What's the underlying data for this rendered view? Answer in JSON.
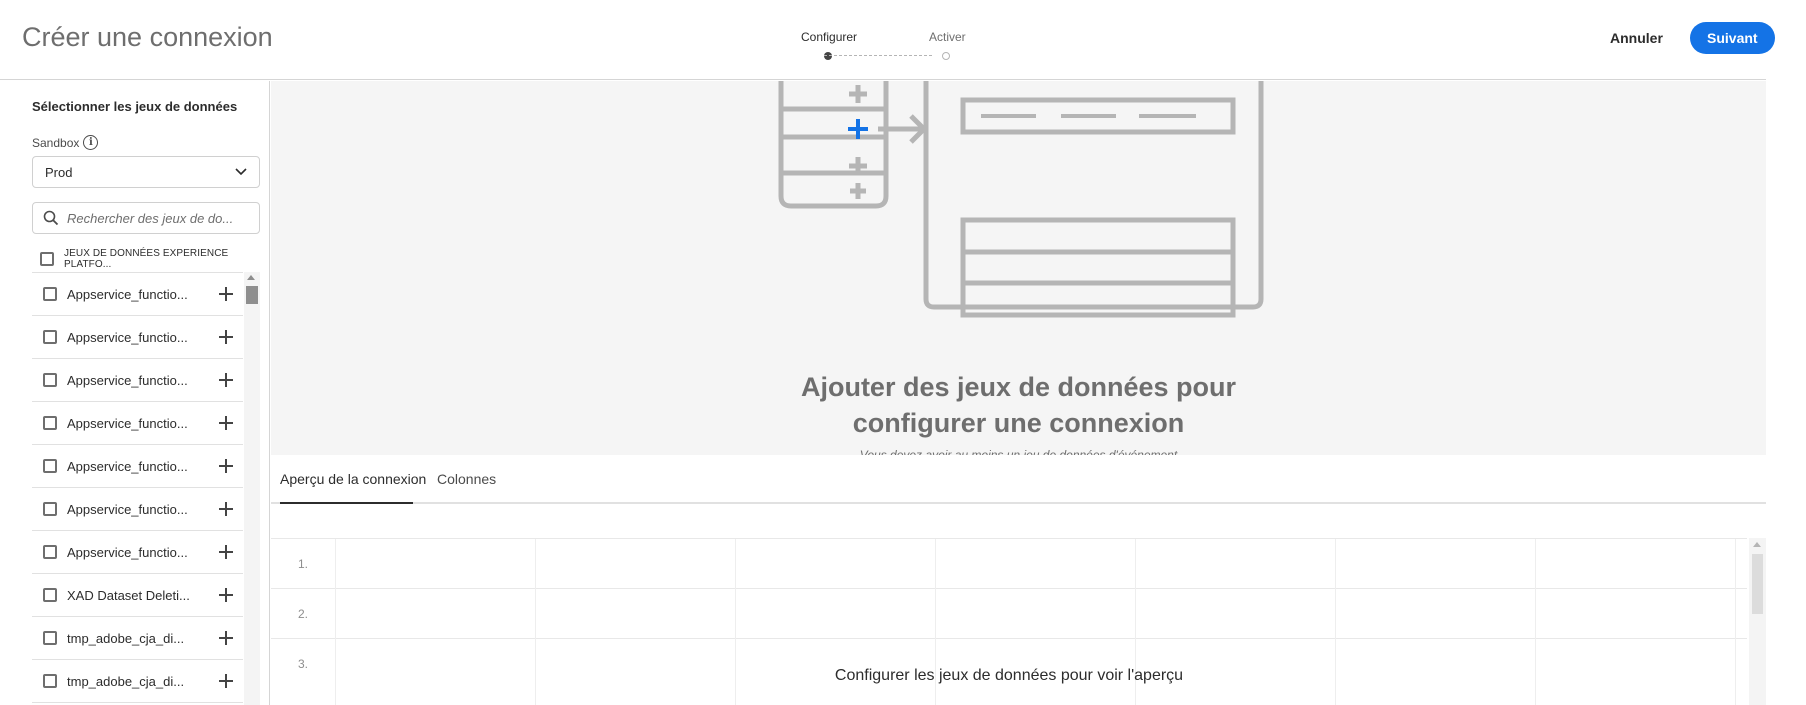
{
  "header": {
    "title": "Créer une connexion",
    "steps": [
      {
        "label": "Configurer",
        "active": true
      },
      {
        "label": "Activer",
        "active": false
      }
    ],
    "cancel_label": "Annuler",
    "next_label": "Suivant",
    "accent_color": "#1473e6"
  },
  "sidebar": {
    "title": "Sélectionner les jeux de données",
    "sandbox_label": "Sandbox",
    "sandbox_value": "Prod",
    "search_placeholder": "Rechercher des jeux de do...",
    "all_label": "JEUX DE DONNÉES EXPERIENCE PLATFO...",
    "items": [
      {
        "label": "Appservice_functio..."
      },
      {
        "label": "Appservice_functio..."
      },
      {
        "label": "Appservice_functio..."
      },
      {
        "label": "Appservice_functio..."
      },
      {
        "label": "Appservice_functio..."
      },
      {
        "label": "Appservice_functio..."
      },
      {
        "label": "Appservice_functio..."
      },
      {
        "label": "XAD Dataset Deleti..."
      },
      {
        "label": "tmp_adobe_cja_di..."
      },
      {
        "label": "tmp_adobe_cja_di..."
      }
    ]
  },
  "canvas": {
    "empty_title_line1": "Ajouter des jeux de données pour",
    "empty_title_line2": "configurer une connexion",
    "empty_subtitle": "Vous devez avoir au moins un jeu de données d'événement"
  },
  "preview": {
    "tabs": [
      {
        "label": "Aperçu de la connexion",
        "active": true
      },
      {
        "label": "Colonnes",
        "active": false
      }
    ],
    "row_numbers": [
      "1.",
      "2.",
      "3."
    ],
    "message": "Configurer les jeux de données pour voir l'aperçu"
  }
}
